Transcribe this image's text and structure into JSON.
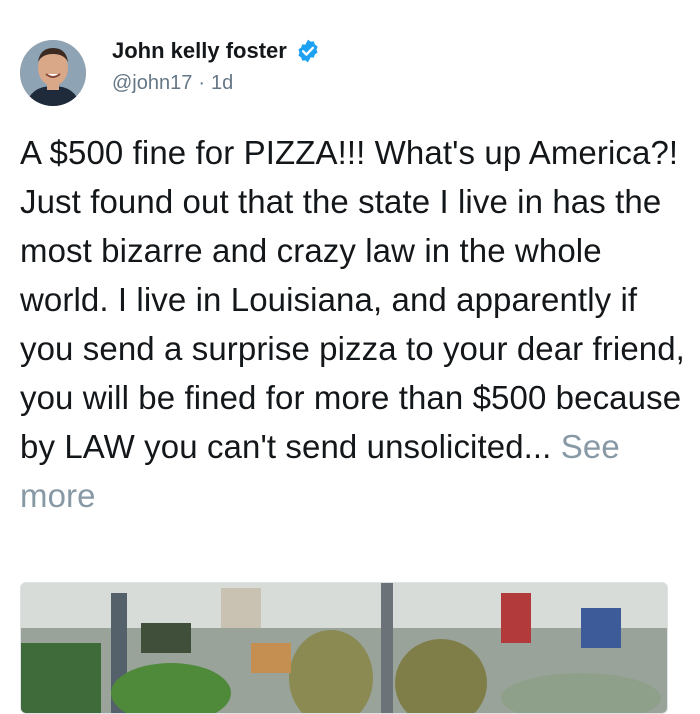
{
  "tweet": {
    "author": {
      "display_name": "John kelly foster",
      "handle": "@john17",
      "verified": true
    },
    "separator": "·",
    "time": "1d",
    "body": "A $500 fine for PIZZA!!! What's up America?! Just found out that the state I live in has the most bizarre and crazy law in the whole world. I live in Louisiana, and apparently if you send a surprise pizza to your dear friend, you will be fined for more than $500 because by LAW you can't send unsolicited...",
    "see_more_label": "See more",
    "media": {
      "type": "photo",
      "alt": ""
    }
  },
  "colors": {
    "text": "#14171a",
    "muted": "#657786",
    "verified_blue": "#1da1f2",
    "see_more": "#8899a6"
  }
}
